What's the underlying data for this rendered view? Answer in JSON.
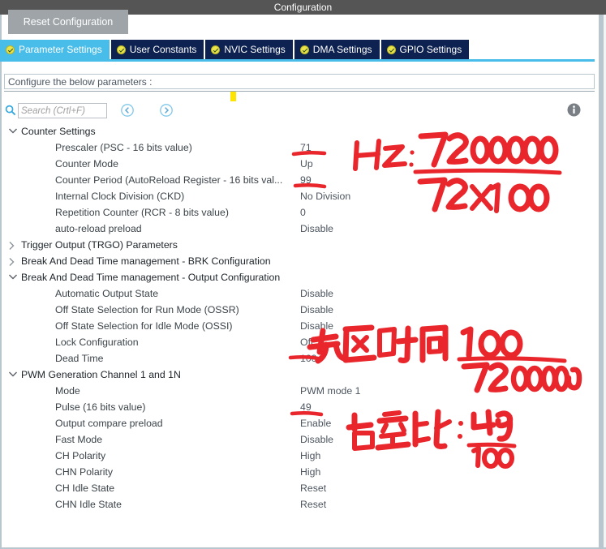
{
  "window": {
    "title": "Configuration"
  },
  "toolbar": {
    "reset_label": "Reset Configuration"
  },
  "tabs": [
    {
      "label": "Parameter Settings",
      "icon": "check-circle-icon",
      "active": true
    },
    {
      "label": "User Constants",
      "icon": "check-circle-icon",
      "active": false
    },
    {
      "label": "NVIC Settings",
      "icon": "check-circle-icon",
      "active": false
    },
    {
      "label": "DMA Settings",
      "icon": "check-circle-icon",
      "active": false
    },
    {
      "label": "GPIO Settings",
      "icon": "check-circle-icon",
      "active": false
    }
  ],
  "configbar": {
    "text": "Configure the below parameters :"
  },
  "search": {
    "value": "",
    "placeholder": "Search (Crtl+F)",
    "icon": "search-icon",
    "back_icon": "circle-left-arrow-icon",
    "forward_icon": "circle-right-arrow-icon"
  },
  "info": {
    "icon": "info-icon"
  },
  "tree": {
    "groups": [
      {
        "label": "Counter Settings",
        "expanded": true,
        "rows": [
          {
            "label": "Prescaler (PSC - 16 bits value)",
            "value": "71"
          },
          {
            "label": "Counter Mode",
            "value": "Up"
          },
          {
            "label": "Counter Period (AutoReload Register - 16 bits val...",
            "value": "99"
          },
          {
            "label": "Internal Clock Division (CKD)",
            "value": "No Division"
          },
          {
            "label": "Repetition Counter (RCR - 8 bits value)",
            "value": "0"
          },
          {
            "label": "auto-reload preload",
            "value": "Disable"
          }
        ]
      },
      {
        "label": "Trigger Output (TRGO) Parameters",
        "expanded": false,
        "rows": []
      },
      {
        "label": "Break And Dead Time management - BRK Configuration",
        "expanded": false,
        "rows": []
      },
      {
        "label": "Break And Dead Time management - Output Configuration",
        "expanded": true,
        "rows": [
          {
            "label": "Automatic Output State",
            "value": "Disable"
          },
          {
            "label": "Off State Selection for Run Mode (OSSR)",
            "value": "Disable"
          },
          {
            "label": "Off State Selection for Idle Mode (OSSI)",
            "value": "Disable"
          },
          {
            "label": "Lock Configuration",
            "value": "Off"
          },
          {
            "label": "Dead Time",
            "value": "100"
          }
        ]
      },
      {
        "label": "PWM Generation Channel 1 and 1N",
        "expanded": true,
        "rows": [
          {
            "label": "Mode",
            "value": "PWM mode 1"
          },
          {
            "label": "Pulse (16 bits value)",
            "value": "49"
          },
          {
            "label": "Output compare preload",
            "value": "Enable"
          },
          {
            "label": "Fast Mode",
            "value": "Disable"
          },
          {
            "label": "CH Polarity",
            "value": "High"
          },
          {
            "label": "CHN Polarity",
            "value": "High"
          },
          {
            "label": "CH Idle State",
            "value": "Reset"
          },
          {
            "label": "CHN Idle State",
            "value": "Reset"
          }
        ]
      }
    ]
  },
  "annotations": [
    {
      "name": "frequency-annotation",
      "text": "Hz : 72000000 / 72x100",
      "prefix": "Hz :",
      "numerator": "72000000",
      "denominator": "72x100",
      "color": "#e8262b"
    },
    {
      "name": "dead-time-annotation",
      "text": "死区时间 100 / 72000000",
      "prefix": "死区时间",
      "numerator": "100",
      "denominator": "72000000",
      "color": "#e8262b"
    },
    {
      "name": "duty-cycle-annotation",
      "text": "占空比 : 49 / 100",
      "prefix": "占空比 :",
      "numerator": "49",
      "denominator": "100",
      "color": "#e8262b"
    }
  ],
  "colors": {
    "titlebar": "#555555",
    "tab_active": "#48bde9",
    "tab_inactive": "#0d2250",
    "ink": "#e8262b",
    "marker": "#ffe400",
    "reset_button": "#9ea4a8"
  }
}
